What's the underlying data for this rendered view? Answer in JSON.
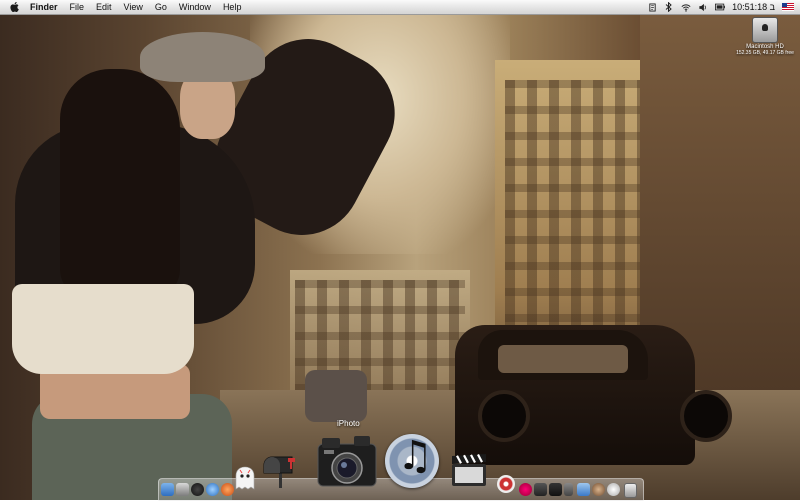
{
  "menubar": {
    "app_name": "Finder",
    "items": [
      "File",
      "Edit",
      "View",
      "Go",
      "Window",
      "Help"
    ],
    "clock": "ב 10:51:18",
    "status_icons": [
      "script-icon",
      "bluetooth-icon",
      "wifi-icon",
      "volume-icon",
      "battery-icon",
      "input-flag-icon"
    ]
  },
  "desktop": {
    "hard_drive": {
      "name": "Macintosh HD",
      "info": "152.35 GB, 49.17 GB free"
    }
  },
  "dock": {
    "hover_label": "iPhoto",
    "items_left": [
      "finder-icon",
      "dashboard-icon",
      "mail-icon",
      "safari-icon",
      "ichat-icon",
      "addressbook-icon"
    ],
    "items_main": [
      "ghost-icon",
      "mailbox-icon",
      "iphoto-camera-icon",
      "itunes-icon",
      "imovie-icon"
    ],
    "items_right": [
      "record-icon",
      "app-icon",
      "app-icon",
      "app-icon",
      "app-icon",
      "app-icon",
      "app-icon",
      "app-icon",
      "trash-icon"
    ]
  }
}
